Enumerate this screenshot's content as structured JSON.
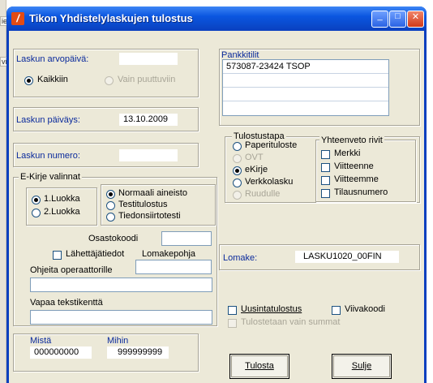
{
  "background_tabs": [
    "ie",
    "vit"
  ],
  "window": {
    "title": "Tikon Yhdistelylaskujen tulostus",
    "app_icon_glyph": "/",
    "controls": {
      "minimize": "_",
      "maximize": "□",
      "close": "✕"
    }
  },
  "arvopaiva": {
    "label": "Laskun arvopäivä:",
    "value": "",
    "options": [
      "Kaikkiin",
      "Vain puuttuviin"
    ],
    "selected": "Kaikkiin"
  },
  "paivays": {
    "label": "Laskun päiväys:",
    "value": "13.10.2009"
  },
  "numero": {
    "label": "Laskun numero:",
    "value": ""
  },
  "ekirje": {
    "group_label": "E-Kirje valinnat",
    "luokka_options": [
      "1.Luokka",
      "2.Luokka"
    ],
    "luokka_selected": "1.Luokka",
    "aineisto_options": [
      "Normaali aineisto",
      "Testitulostus",
      "Tiedonsiirtotesti"
    ],
    "aineisto_selected": "Normaali aineisto",
    "osastokoodi_label": "Osastokoodi",
    "osastokoodi_value": "",
    "lahettaja_label": "Lähettäjätiedot",
    "lomakepohja_label": "Lomakepohja",
    "lomakepohja_value": "",
    "ohjeita_label": "Ohjeita operaattorille",
    "ohjeita_value": "",
    "vapaa_label": "Vapaa tekstikenttä",
    "vapaa_value": ""
  },
  "range": {
    "from_label": "Mistä",
    "from_value": "000000000",
    "to_label": "Mihin",
    "to_value": "999999999"
  },
  "pankkitilit": {
    "label": "Pankkitilit",
    "rows": [
      "573087-23424 TSOP",
      "",
      "",
      ""
    ]
  },
  "tulostustapa": {
    "label": "Tulostustapa",
    "options": [
      {
        "text": "Paperituloste",
        "enabled": true
      },
      {
        "text": "OVT",
        "enabled": false
      },
      {
        "text": "eKirje",
        "enabled": true
      },
      {
        "text": "Verkkolasku",
        "enabled": true
      },
      {
        "text": "Ruudulle",
        "enabled": false
      }
    ],
    "selected": "eKirje"
  },
  "yhteenveto": {
    "label": "Yhteenveto rivit",
    "options": [
      "Merkki",
      "Viitteenne",
      "Viitteemme",
      "Tilausnumero"
    ]
  },
  "lomake": {
    "label": "Lomake:",
    "value": "LASKU1020_00FIN"
  },
  "uusinta": {
    "label": "Uusintatulostus"
  },
  "viivakoodi": {
    "label": "Viivakoodi"
  },
  "summat": {
    "label": "Tulostetaan vain summat"
  },
  "buttons": {
    "tulosta": "Tulosta",
    "sulje": "Sulje"
  },
  "colors": {
    "titlebar": "#0a48c9",
    "client": "#ece9d8",
    "label_blue": "#0a2a9c",
    "close_button": "#d23a1a"
  }
}
